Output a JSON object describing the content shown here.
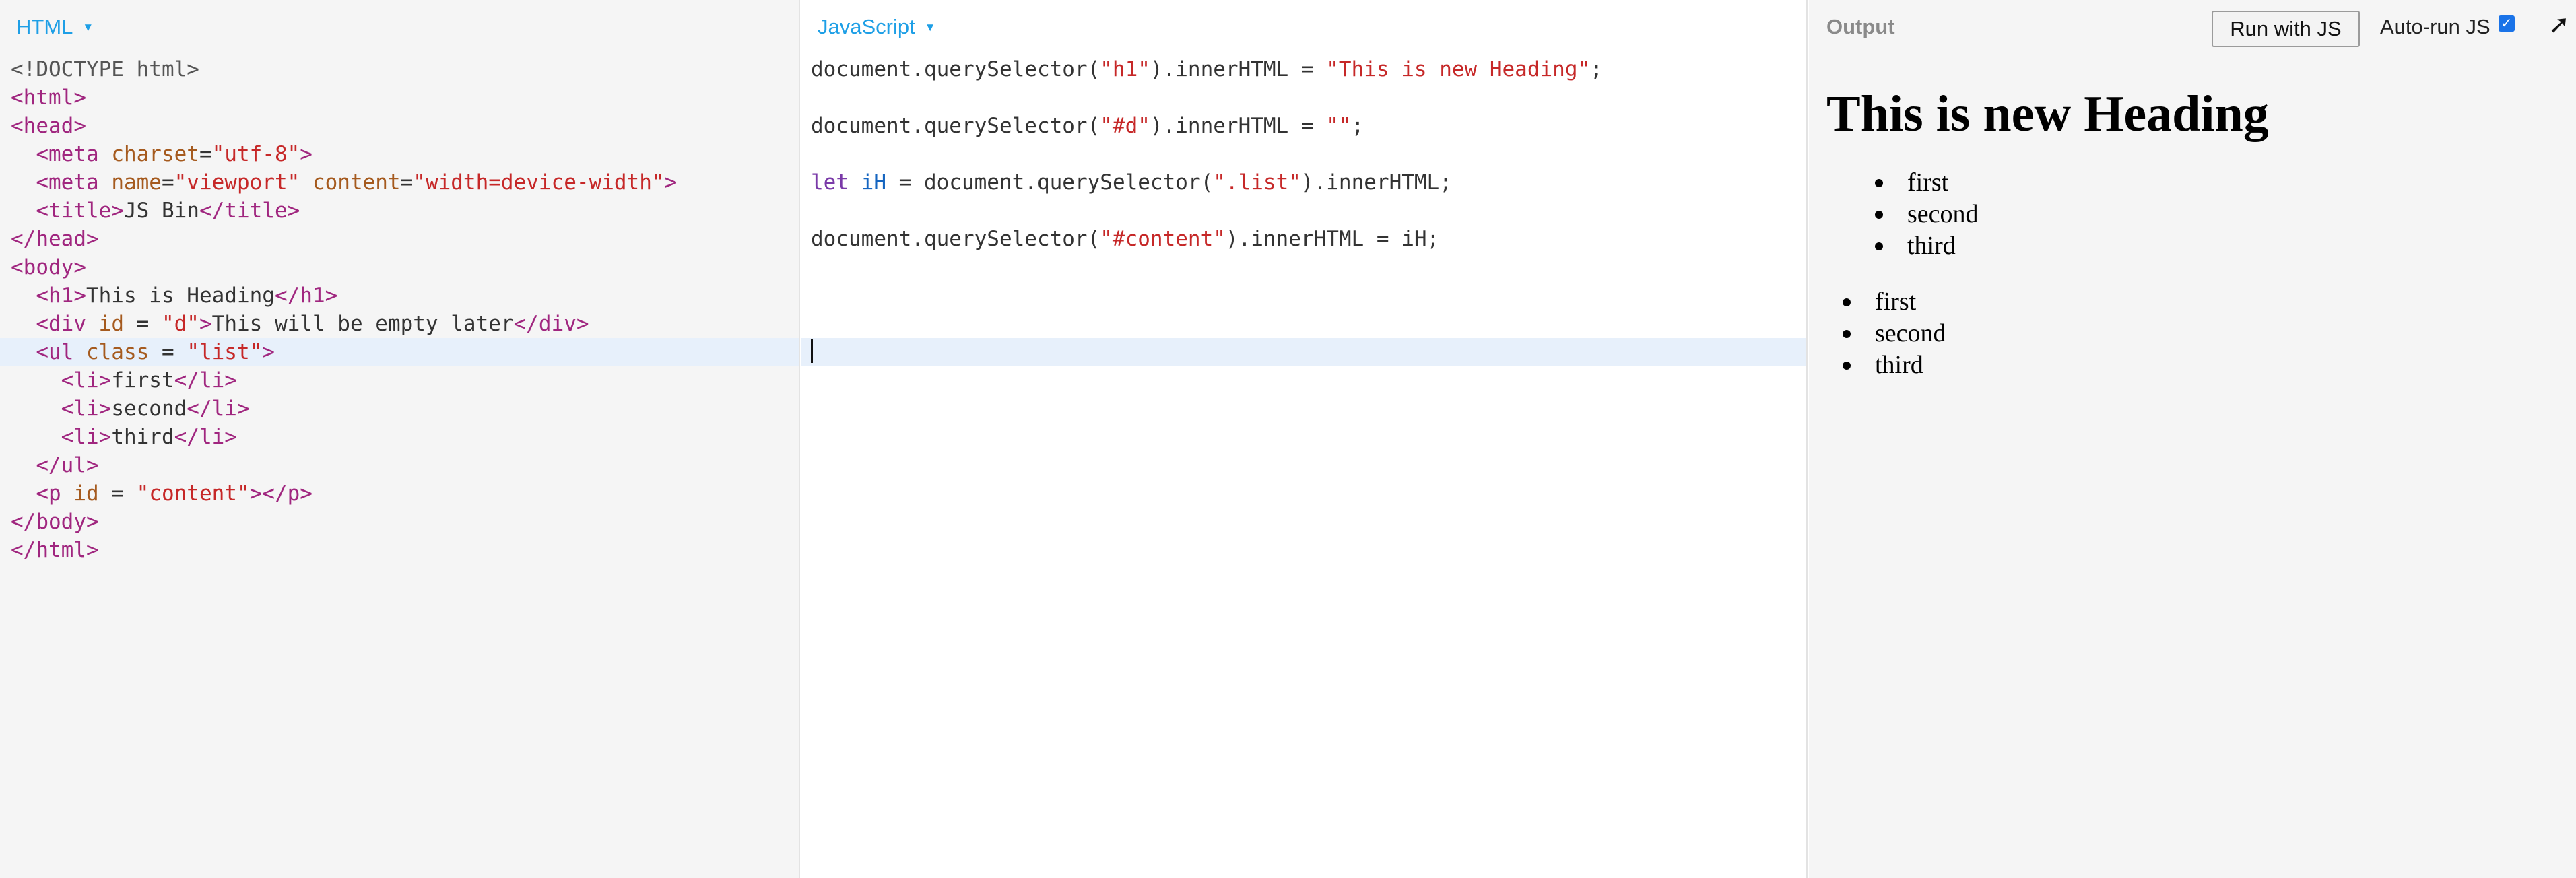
{
  "html_panel": {
    "label": "HTML",
    "lines": [
      [
        {
          "t": "<!DOCTYPE html>",
          "c": "doc"
        }
      ],
      [
        {
          "t": "<html>",
          "c": "tag"
        }
      ],
      [
        {
          "t": "<head>",
          "c": "tag"
        }
      ],
      [
        {
          "t": "  "
        },
        {
          "t": "<meta ",
          "c": "tag"
        },
        {
          "t": "charset",
          "c": "attr"
        },
        {
          "t": "=",
          "c": "txt"
        },
        {
          "t": "\"utf-8\"",
          "c": "str"
        },
        {
          "t": ">",
          "c": "tag"
        }
      ],
      [
        {
          "t": "  "
        },
        {
          "t": "<meta ",
          "c": "tag"
        },
        {
          "t": "name",
          "c": "attr"
        },
        {
          "t": "=",
          "c": "txt"
        },
        {
          "t": "\"viewport\"",
          "c": "str"
        },
        {
          "t": " "
        },
        {
          "t": "content",
          "c": "attr"
        },
        {
          "t": "=",
          "c": "txt"
        },
        {
          "t": "\"width=device-width\"",
          "c": "str"
        },
        {
          "t": ">",
          "c": "tag"
        }
      ],
      [
        {
          "t": "  "
        },
        {
          "t": "<title>",
          "c": "tag"
        },
        {
          "t": "JS Bin",
          "c": "txt"
        },
        {
          "t": "</title>",
          "c": "tag"
        }
      ],
      [
        {
          "t": "</head>",
          "c": "tag"
        }
      ],
      [
        {
          "t": "<body>",
          "c": "tag"
        }
      ],
      [
        {
          "t": "  "
        },
        {
          "t": "<h1>",
          "c": "tag"
        },
        {
          "t": "This is Heading",
          "c": "txt"
        },
        {
          "t": "</h1>",
          "c": "tag"
        }
      ],
      [
        {
          "t": "  "
        },
        {
          "t": "<div ",
          "c": "tag"
        },
        {
          "t": "id",
          "c": "attr"
        },
        {
          "t": " = ",
          "c": "txt"
        },
        {
          "t": "\"d\"",
          "c": "str"
        },
        {
          "t": ">",
          "c": "tag"
        },
        {
          "t": "This will be empty later",
          "c": "txt"
        },
        {
          "t": "</div>",
          "c": "tag"
        }
      ],
      [
        {
          "t": "  "
        },
        {
          "t": "<ul ",
          "c": "tag"
        },
        {
          "t": "class",
          "c": "attr"
        },
        {
          "t": " = ",
          "c": "txt"
        },
        {
          "t": "\"list\"",
          "c": "str"
        },
        {
          "t": ">",
          "c": "tag"
        }
      ],
      [
        {
          "t": "    "
        },
        {
          "t": "<li>",
          "c": "tag"
        },
        {
          "t": "first",
          "c": "txt"
        },
        {
          "t": "</li>",
          "c": "tag"
        }
      ],
      [
        {
          "t": "    "
        },
        {
          "t": "<li>",
          "c": "tag"
        },
        {
          "t": "second",
          "c": "txt"
        },
        {
          "t": "</li>",
          "c": "tag"
        }
      ],
      [
        {
          "t": "    "
        },
        {
          "t": "<li>",
          "c": "tag"
        },
        {
          "t": "third",
          "c": "txt"
        },
        {
          "t": "</li>",
          "c": "tag"
        }
      ],
      [
        {
          "t": "  "
        },
        {
          "t": "</ul>",
          "c": "tag"
        }
      ],
      [
        {
          "t": "  "
        },
        {
          "t": "<p ",
          "c": "tag"
        },
        {
          "t": "id",
          "c": "attr"
        },
        {
          "t": " = ",
          "c": "txt"
        },
        {
          "t": "\"content\"",
          "c": "str"
        },
        {
          "t": "></p>",
          "c": "tag"
        }
      ],
      [
        {
          "t": "</body>",
          "c": "tag"
        }
      ],
      [
        {
          "t": "</html>",
          "c": "tag"
        }
      ]
    ],
    "active_line": 10
  },
  "js_panel": {
    "label": "JavaScript",
    "lines": [
      [
        {
          "t": "document.querySelector(",
          "c": "txt"
        },
        {
          "t": "\"h1\"",
          "c": "str"
        },
        {
          "t": ").innerHTML = ",
          "c": "txt"
        },
        {
          "t": "\"This is new Heading\"",
          "c": "str"
        },
        {
          "t": ";",
          "c": "txt"
        }
      ],
      [],
      [
        {
          "t": "document.querySelector(",
          "c": "txt"
        },
        {
          "t": "\"#d\"",
          "c": "str"
        },
        {
          "t": ").innerHTML = ",
          "c": "txt"
        },
        {
          "t": "\"\"",
          "c": "str"
        },
        {
          "t": ";",
          "c": "txt"
        }
      ],
      [],
      [
        {
          "t": "let",
          "c": "kw"
        },
        {
          "t": " "
        },
        {
          "t": "iH",
          "c": "var"
        },
        {
          "t": " = document.querySelector(",
          "c": "txt"
        },
        {
          "t": "\".list\"",
          "c": "str"
        },
        {
          "t": ").innerHTML;",
          "c": "txt"
        }
      ],
      [],
      [
        {
          "t": "document.querySelector(",
          "c": "txt"
        },
        {
          "t": "\"#content\"",
          "c": "str"
        },
        {
          "t": ").innerHTML = iH;",
          "c": "txt"
        }
      ],
      [],
      [],
      [],
      [
        {
          "cursor": true
        }
      ]
    ],
    "active_line": 10
  },
  "output_panel": {
    "label": "Output",
    "run_button_label": "Run with JS",
    "autorun_label": "Auto-run JS",
    "autorun_checked": true,
    "popout_icon": "arrow-up-right-icon",
    "heading": "This is new Heading",
    "list1": [
      "first",
      "second",
      "third"
    ],
    "list2": [
      "first",
      "second",
      "third"
    ]
  },
  "colors": {
    "label_blue": "#1e9fe6",
    "tag": "#a0267f",
    "attr": "#a55a1e",
    "string": "#c62828",
    "keyword": "#7a3aa8",
    "variable": "#1565c0",
    "active_line_bg": "#e7f0fb",
    "checkbox_blue": "#1a73e8"
  }
}
